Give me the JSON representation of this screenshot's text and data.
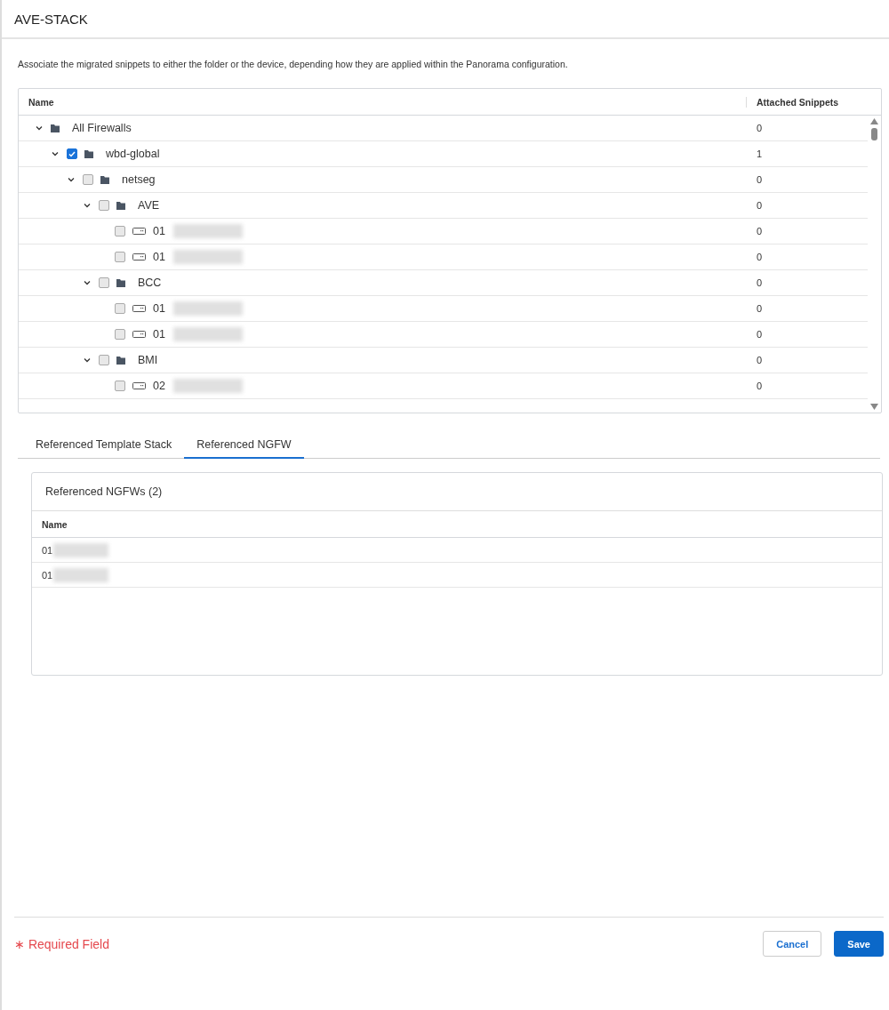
{
  "dialog": {
    "title": "AVE-STACK"
  },
  "description": "Associate the migrated snippets to either the folder or the device, depending how they are applied within the Panorama configuration.",
  "tree": {
    "columns": [
      "Name",
      "Attached Snippets"
    ],
    "items": [
      {
        "kind": "root",
        "name": "All Firewalls",
        "snippets": "0",
        "expanded": true,
        "children": [
          {
            "kind": "folder",
            "name": "wbd-global",
            "snippets": "1",
            "expanded": true,
            "checked": true,
            "children": [
              {
                "kind": "folder",
                "name": "netseg",
                "snippets": "0",
                "expanded": true,
                "checked": false,
                "children": [
                  {
                    "kind": "folder",
                    "name": "AVE",
                    "snippets": "0",
                    "expanded": true,
                    "checked": false,
                    "children": [
                      {
                        "kind": "device",
                        "name": "01",
                        "snippets": "0",
                        "checked": false
                      },
                      {
                        "kind": "device",
                        "name": "01",
                        "snippets": "0",
                        "checked": false
                      }
                    ]
                  },
                  {
                    "kind": "folder",
                    "name": "BCC",
                    "snippets": "0",
                    "expanded": true,
                    "checked": false,
                    "children": [
                      {
                        "kind": "device",
                        "name": "01",
                        "snippets": "0",
                        "checked": false
                      },
                      {
                        "kind": "device",
                        "name": "01",
                        "snippets": "0",
                        "checked": false
                      }
                    ]
                  },
                  {
                    "kind": "folder",
                    "name": "BMI",
                    "snippets": "0",
                    "expanded": true,
                    "checked": false,
                    "children": [
                      {
                        "kind": "device",
                        "name": "02",
                        "snippets": "0",
                        "checked": false
                      }
                    ]
                  }
                ]
              }
            ]
          }
        ]
      }
    ]
  },
  "tabs": [
    {
      "label": "Referenced Template Stack",
      "selected": false
    },
    {
      "label": "Referenced NGFW",
      "selected": true
    }
  ],
  "ngfw_card": {
    "title": "Referenced NGFWs (2)",
    "columns": [
      "Name"
    ],
    "rows": [
      "01",
      "01"
    ]
  },
  "footer": {
    "required": "Required Field",
    "required_mark": "∗",
    "buttons": [
      {
        "label": "Cancel",
        "kind": "secondary"
      },
      {
        "label": "Save",
        "kind": "primary"
      }
    ]
  }
}
